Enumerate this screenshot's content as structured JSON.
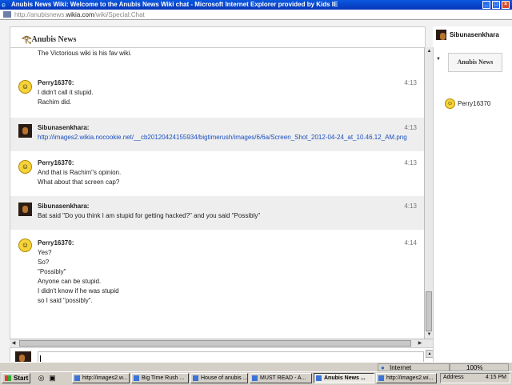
{
  "window": {
    "title": "Anubis News Wiki: Welcome to the Anubis News Wiki chat - Microsoft Internet Explorer provided by Kids IE",
    "address_prefix": "http://anubisnews.",
    "address_domain": "wikia.com",
    "address_path": "/wiki/Special:Chat"
  },
  "header": {
    "logo_text": "Anubis News"
  },
  "messages": [
    {
      "name": "",
      "time": "",
      "lines": [
        "The Victorious wiki is his fav wiki."
      ],
      "avatar": "dark"
    },
    {
      "name": "Perry16370:",
      "time": "4:13",
      "lines": [
        "I didn't call it stupid.",
        "Rachim did."
      ],
      "avatar": "smiley"
    },
    {
      "name": "Sibunasenkhara:",
      "time": "4:13",
      "lines": [
        "http://images2.wikia.nocookie.net/__cb20120424155934/bigtimerush/images/6/6a/Screen_Shot_2012-04-24_at_10.46.12_AM.png"
      ],
      "avatar": "dark"
    },
    {
      "name": "Perry16370:",
      "time": "4:13",
      "lines": [
        "And that is Rachim\"s opinion.",
        "What about that screen cap?"
      ],
      "avatar": "smiley"
    },
    {
      "name": "Sibunasenkhara:",
      "time": "4:13",
      "lines": [
        "Bat said \"Do you think I am stupid for getting hacked?\" and you said \"Possibly\""
      ],
      "avatar": "dark"
    },
    {
      "name": "Perry16370:",
      "time": "4:14",
      "lines": [
        "Yes?",
        "So?",
        "\"Possibly\"",
        "Anyone can be stupid.",
        "I didn't know if he was stupid",
        "so I said \"possibly\"."
      ],
      "avatar": "smiley"
    }
  ],
  "input": {
    "value": ""
  },
  "sidebar": {
    "current_user": "Sibunasenkhara",
    "room_header": "Anubis News",
    "users": [
      "Perry16370"
    ]
  },
  "statusbar": {
    "zone": "Internet",
    "zoom": "100%"
  },
  "taskbar": {
    "start": "Start",
    "buttons": [
      "http://images2.w...",
      "Big Time Rush ...",
      "House of anubis ...",
      "MUST READ - A...",
      "Anubis News ...",
      "http://images2.wi..."
    ],
    "active_index": 4,
    "address_label": "Address",
    "clock": "4:15 PM"
  }
}
